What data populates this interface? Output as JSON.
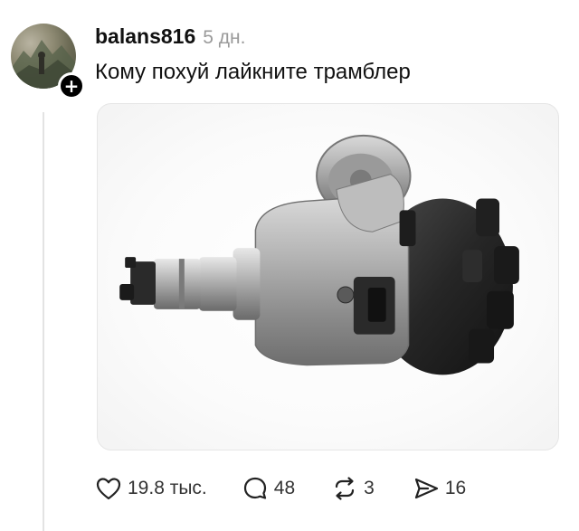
{
  "post": {
    "author": {
      "username": "balans816",
      "avatar_icon": "user-avatar",
      "follow_badge": "+"
    },
    "timestamp": "5 дн.",
    "text": "Кому похуй лайкните трамблер",
    "media": {
      "type": "image",
      "subject": "ignition-distributor"
    },
    "actions": {
      "likes": {
        "icon": "heart-icon",
        "count": "19.8 тыс."
      },
      "replies": {
        "icon": "comment-icon",
        "count": "48"
      },
      "reposts": {
        "icon": "repost-icon",
        "count": "3"
      },
      "shares": {
        "icon": "share-icon",
        "count": "16"
      }
    }
  },
  "colors": {
    "text": "#111111",
    "muted": "#9a9a9a",
    "thread_line": "#e3e3e3",
    "badge": "#000000"
  }
}
